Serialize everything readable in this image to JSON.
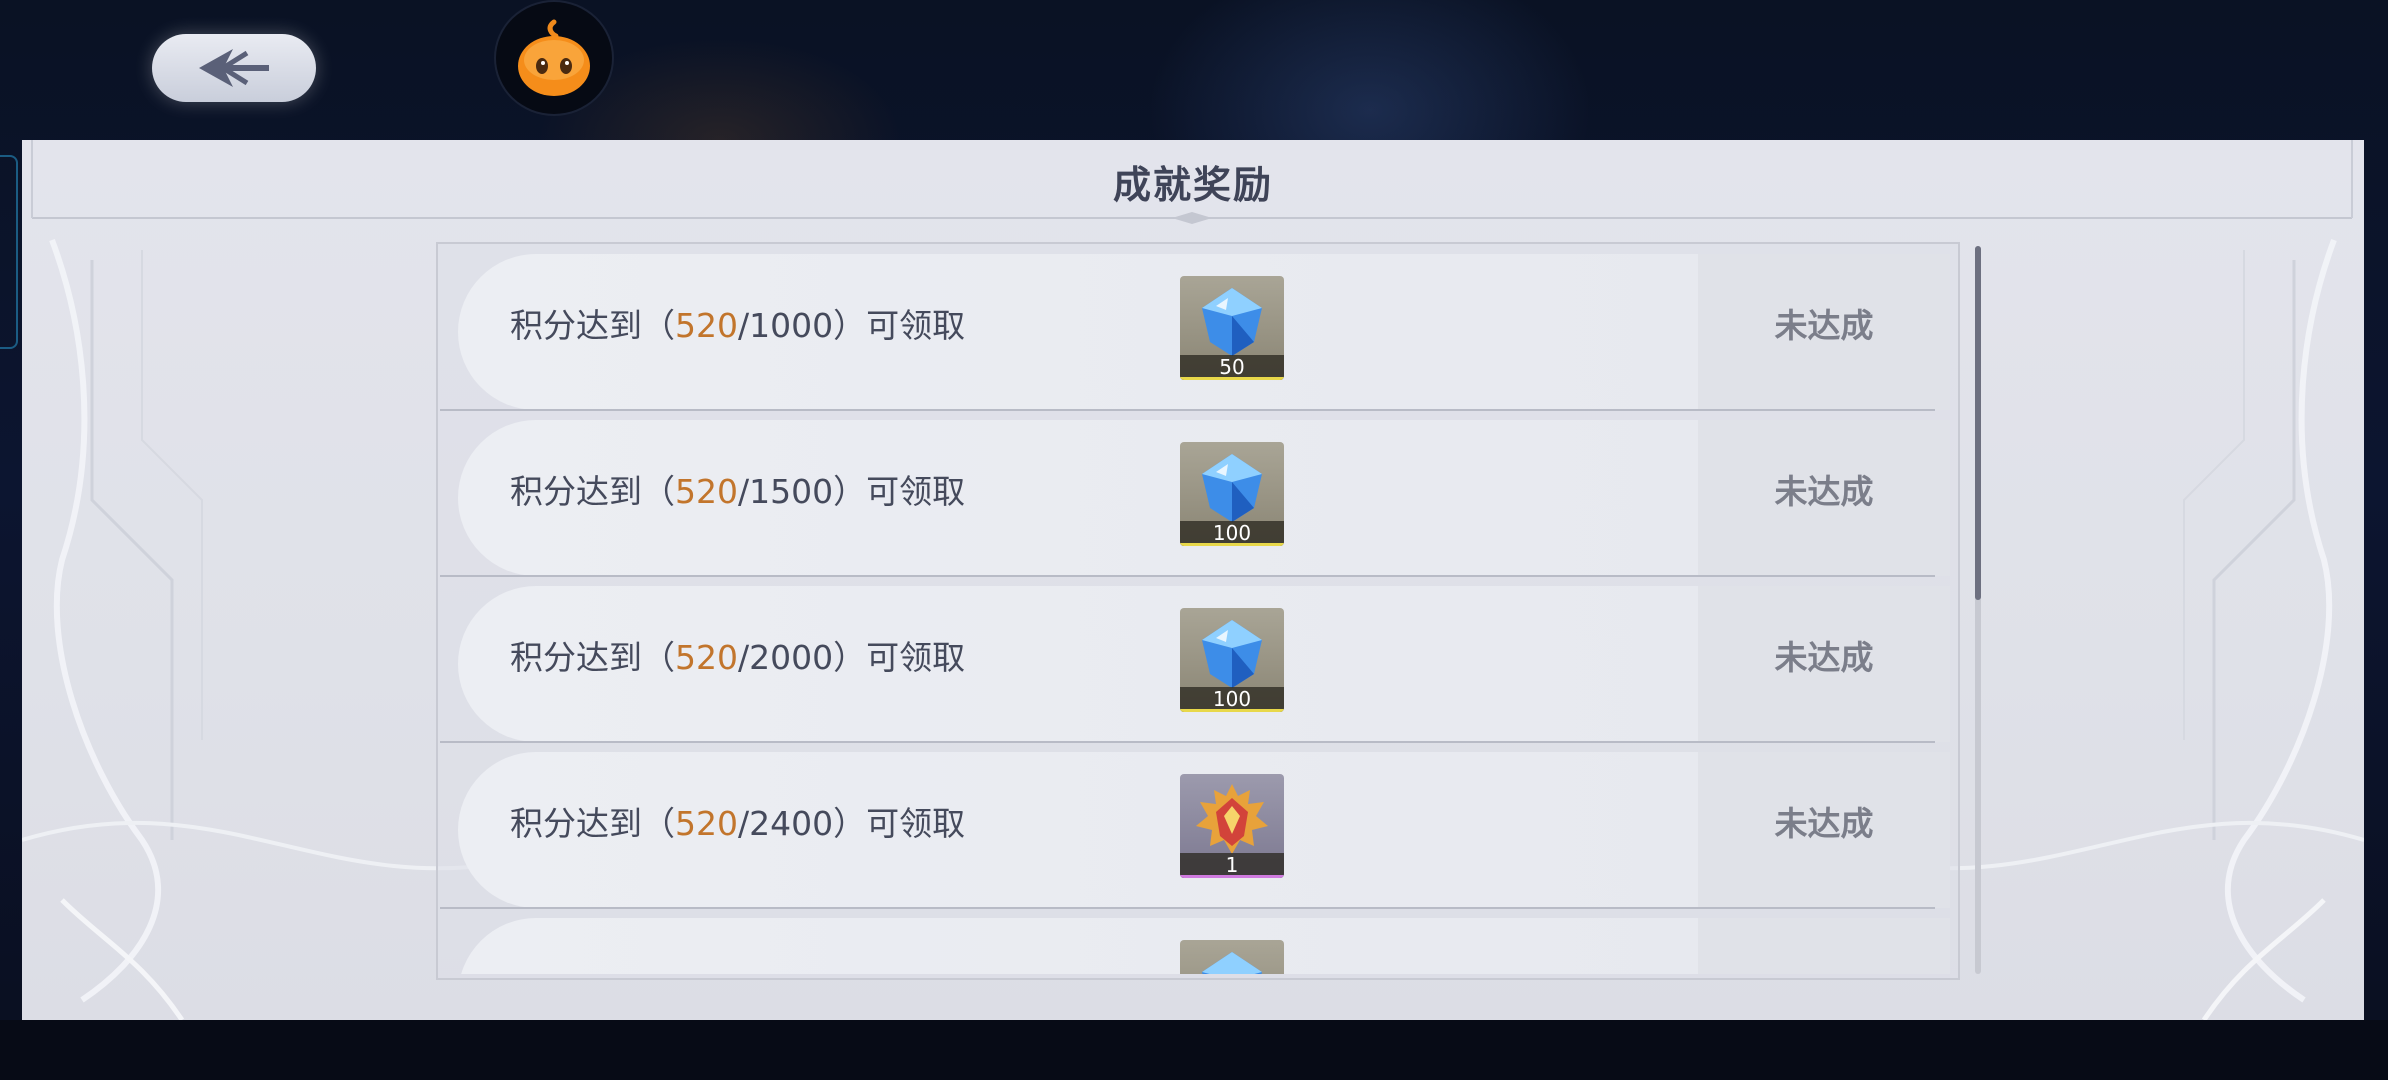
{
  "header": {
    "back_icon": "back-arrow-icon",
    "mascot_icon": "orange-blob-mascot-icon"
  },
  "panel": {
    "title": "成就奖励"
  },
  "rows": [
    {
      "label_prefix": "积分达到（",
      "current": "520",
      "target": "/1000",
      "label_suffix": "）可领取",
      "reward_icon": "blue-diamond-icon",
      "reward_qty": "50",
      "status": "未达成"
    },
    {
      "label_prefix": "积分达到（",
      "current": "520",
      "target": "/1500",
      "label_suffix": "）可领取",
      "reward_icon": "blue-diamond-icon",
      "reward_qty": "100",
      "status": "未达成"
    },
    {
      "label_prefix": "积分达到（",
      "current": "520",
      "target": "/2000",
      "label_suffix": "）可领取",
      "reward_icon": "blue-diamond-icon",
      "reward_qty": "100",
      "status": "未达成"
    },
    {
      "label_prefix": "积分达到（",
      "current": "520",
      "target": "/2400",
      "label_suffix": "）可领取",
      "reward_icon": "golden-crest-badge-icon",
      "reward_qty": "1",
      "status": "未达成"
    },
    {
      "label_prefix": "",
      "current": "",
      "target": "",
      "label_suffix": "",
      "reward_icon": "blue-diamond-icon",
      "reward_qty": "",
      "status": ""
    }
  ],
  "colors": {
    "progress_current": "#c2752c",
    "status_text": "#7b7e8a",
    "panel_bg": "#e3e4ec"
  }
}
